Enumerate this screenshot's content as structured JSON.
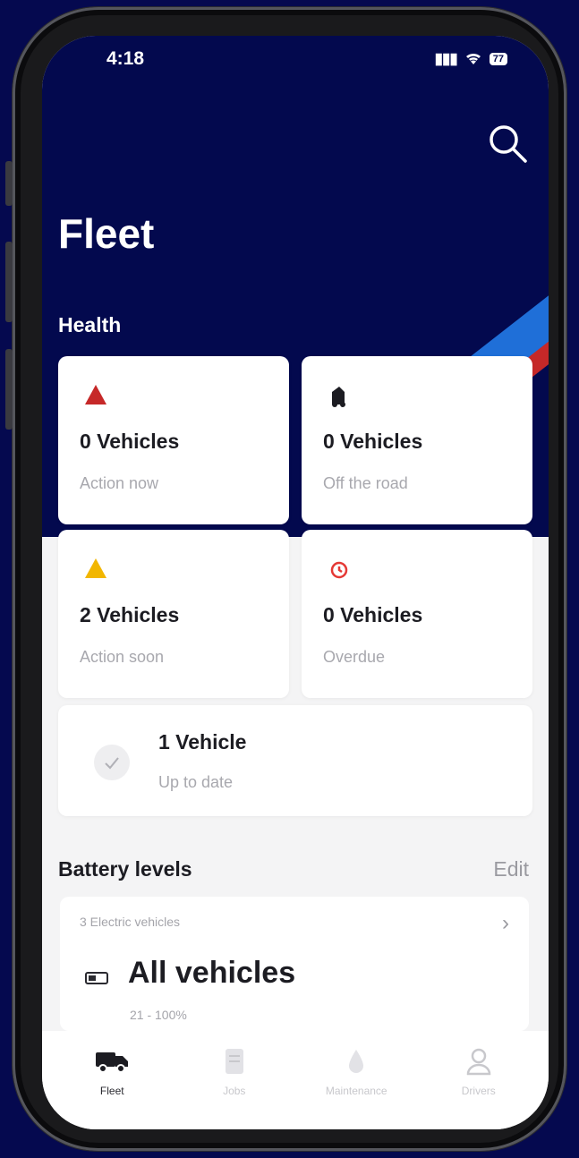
{
  "status_bar": {
    "time": "4:18",
    "battery": "77"
  },
  "header": {
    "title": "Fleet",
    "search_icon": "search-icon"
  },
  "health": {
    "label": "Health",
    "cards": [
      {
        "count": "0 Vehicles",
        "status": "Action now",
        "icon": "warning-triangle-red-icon",
        "color": "#c62828"
      },
      {
        "count": "0 Vehicles",
        "status": "Off the road",
        "icon": "tow-truck-icon",
        "color": "#1c1c22"
      },
      {
        "count": "2 Vehicles",
        "status": "Action soon",
        "icon": "warning-triangle-yellow-icon",
        "color": "#f2b600"
      },
      {
        "count": "0 Vehicles",
        "status": "Overdue",
        "icon": "overdue-clock-icon",
        "color": "#e53935"
      },
      {
        "count": "1 Vehicle",
        "status": "Up to date",
        "icon": "checkmark-icon",
        "color": "#9a9aa0"
      }
    ]
  },
  "battery": {
    "label": "Battery levels",
    "edit_label": "Edit",
    "ev_count": "3 Electric vehicles",
    "title": "All vehicles",
    "range": "21 - 100%"
  },
  "tabbar": {
    "items": [
      {
        "label": "Fleet",
        "icon": "truck-icon",
        "active": true
      },
      {
        "label": "Jobs",
        "icon": "document-icon",
        "active": false
      },
      {
        "label": "Maintenance",
        "icon": "drop-icon",
        "active": false
      },
      {
        "label": "Drivers",
        "icon": "person-icon",
        "active": false
      }
    ]
  },
  "colors": {
    "brand_navy": "#03094e",
    "accent_blue": "#1f6fd8",
    "accent_red": "#c62828"
  }
}
